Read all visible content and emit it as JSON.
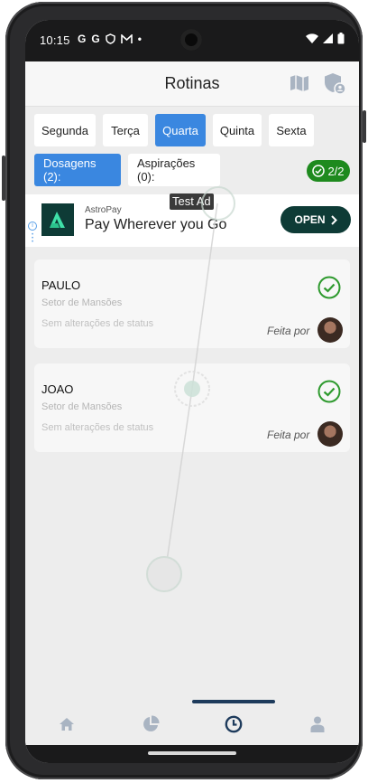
{
  "status_bar": {
    "time": "10:15",
    "notification_icons": [
      "G",
      "G",
      "shield-icon",
      "gmail-icon",
      "•"
    ],
    "right_icons": [
      "wifi-icon",
      "signal-icon",
      "battery-icon"
    ]
  },
  "app_bar": {
    "title": "Rotinas",
    "actions": [
      "map-icon",
      "shield-user-icon"
    ]
  },
  "days": [
    {
      "label": "Segunda",
      "active": false
    },
    {
      "label": "Terça",
      "active": false
    },
    {
      "label": "Quarta",
      "active": true
    },
    {
      "label": "Quinta",
      "active": false
    },
    {
      "label": "Sexta",
      "active": false
    }
  ],
  "tabs": {
    "dosagens": "Dosagens (2):",
    "aspiracoes": "Aspirações (0):"
  },
  "completion_badge": "2/2",
  "ad": {
    "test_label": "Test Ad",
    "brand": "AstroPay",
    "headline": "Pay Wherever you Go",
    "cta": "OPEN"
  },
  "cards": [
    {
      "name": "PAULO",
      "sector": "Setor de Mansões",
      "status": "Sem alterações de status",
      "done_label": "Feita  por"
    },
    {
      "name": "JOAO",
      "sector": "Setor de Mansões",
      "status": "Sem alterações de status",
      "done_label": "Feita  por"
    }
  ],
  "bottom_nav": [
    "home-icon",
    "pie-chart-icon",
    "clock-icon",
    "person-icon"
  ],
  "colors": {
    "accent": "#3a87e0",
    "success": "#1e8a1e",
    "ad_brand": "#0e3b36",
    "nav_active": "#1e3b5c",
    "nav_inactive": "#a9b4c2"
  }
}
